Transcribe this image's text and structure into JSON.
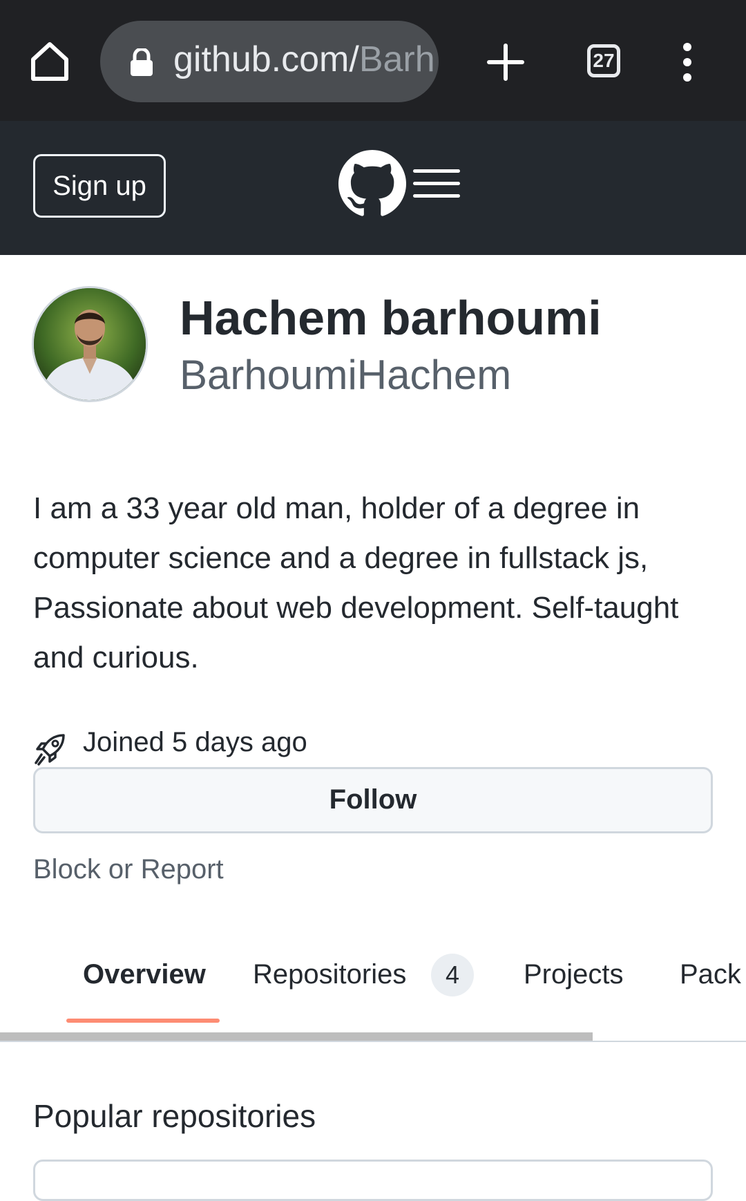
{
  "browser": {
    "url_host": "github.com/",
    "url_path": "Barh",
    "tab_count": "27",
    "icons": [
      "home-icon",
      "lock-icon",
      "plus-icon",
      "tab-switcher-icon",
      "overflow-menu-icon"
    ]
  },
  "header": {
    "signup_label": "Sign up",
    "icons": [
      "github-logo",
      "hamburger-menu-icon"
    ]
  },
  "profile": {
    "display_name": "Hachem barhoumi",
    "username": "BarhoumiHachem",
    "bio": "I am a 33 year old man, holder of a degree in computer science and a degree in fullstack js, Passionate about web development. Self-taught and curious.",
    "joined": "Joined 5 days ago",
    "follow_label": "Follow",
    "block_report_label": "Block or Report"
  },
  "tabs": [
    {
      "label": "Overview",
      "active": true
    },
    {
      "label": "Repositories",
      "count": "4"
    },
    {
      "label": "Projects"
    },
    {
      "label": "Pack"
    }
  ],
  "colors": {
    "chrome_bg": "#202124",
    "header_bg": "#24292f",
    "tab_underline": "#fd8c73"
  },
  "sections": {
    "popular_title": "Popular repositories"
  }
}
